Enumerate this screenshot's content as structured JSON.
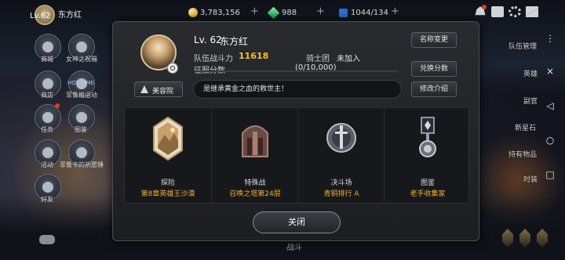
{
  "top_bar": {
    "level": "Lv.62",
    "player_name": "东方红",
    "gold": "3,783,156",
    "gems": "988",
    "stamina": "1044/134"
  },
  "left_menu": [
    {
      "label": "商城",
      "icon": "shop-icon"
    },
    {
      "label": "女神之祝福",
      "icon": "blessing-icon"
    },
    {
      "label": "商店",
      "icon": "store-icon"
    },
    {
      "label": "菲鲁格运动",
      "icon": "hot-time-icon",
      "badge": "HOT TIME"
    },
    {
      "label": "任务",
      "icon": "quest-icon"
    },
    {
      "label": "图鉴",
      "icon": "codex-icon"
    },
    {
      "label": "活动",
      "icon": "event-icon"
    },
    {
      "label": "菲鲁卡的祈愿锤",
      "icon": "hammer-icon"
    },
    {
      "label": "好友",
      "icon": "friends-icon"
    }
  ],
  "right_menu": [
    {
      "label": "队伍管理"
    },
    {
      "label": "英雄"
    },
    {
      "label": "副官"
    },
    {
      "label": "新星石"
    },
    {
      "label": "持有物品"
    },
    {
      "label": "时装"
    }
  ],
  "bottom_label": "战斗",
  "profile": {
    "level": "Lv. 62",
    "name": "东方红",
    "power_label": "队伍战斗力",
    "power_value": "11618",
    "guild_label": "骑士团",
    "guild_value": "未加入",
    "conquest_label": "征服分数",
    "conquest_current": "0",
    "conquest_value": "(0/10,000)",
    "conquest_progress": 0,
    "motto": "是继承黄金之血的救世主！",
    "beauty_button": "美容院",
    "buttons": {
      "rename": "名称变更",
      "exchange": "兑换分数",
      "edit_intro": "修改介绍"
    },
    "close": "关闭"
  },
  "cards": [
    {
      "title": "探险",
      "value": "第8章英雄王沙漠",
      "icon": "desert-crystal-icon"
    },
    {
      "title": "特殊战",
      "value": "召唤之塔第24层",
      "icon": "tower-icon"
    },
    {
      "title": "决斗场",
      "value": "青铜排行 A",
      "icon": "sword-medal-icon"
    },
    {
      "title": "图鉴",
      "value": "老手收集家",
      "icon": "collector-medal-icon"
    }
  ],
  "colors": {
    "accent_gold": "#f0b030",
    "power_gold": "#f0c030",
    "modal_bg": "#232428"
  }
}
